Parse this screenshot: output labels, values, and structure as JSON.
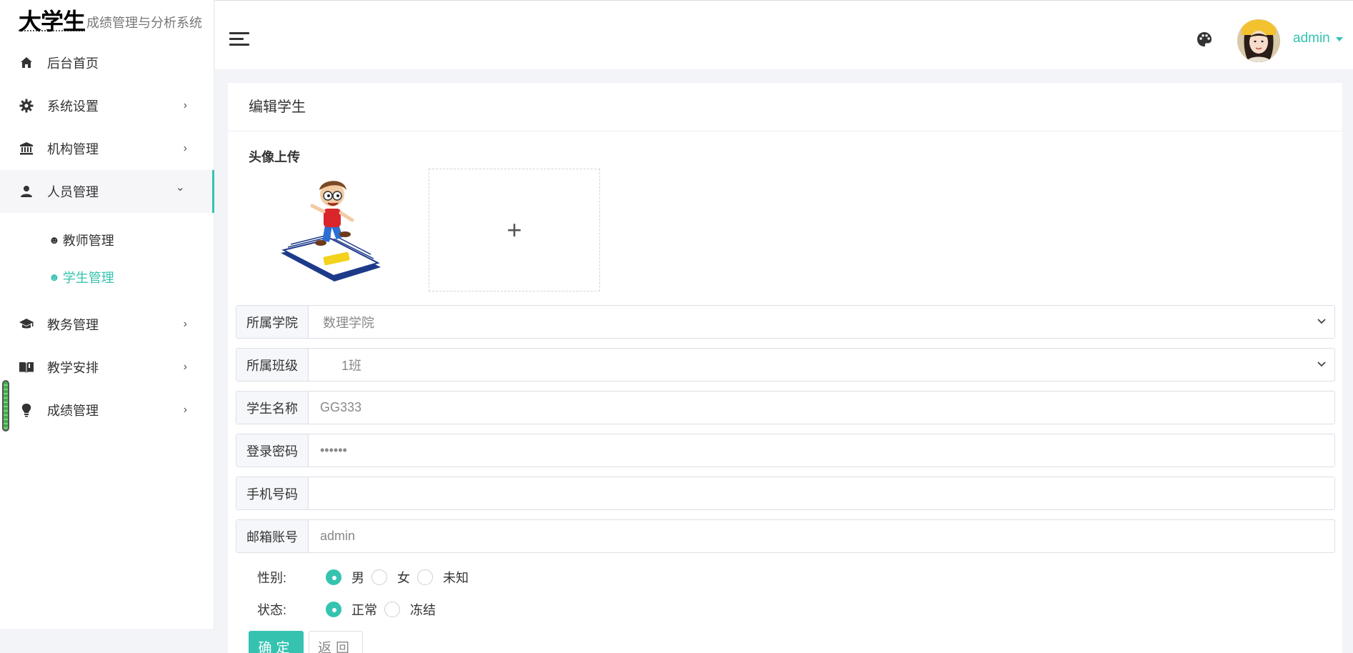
{
  "brand": {
    "big": "大学生",
    "small": "成绩管理与分析系统"
  },
  "sidebar": {
    "items": [
      {
        "label": "后台首页",
        "icon": "home-icon"
      },
      {
        "label": "系统设置",
        "icon": "gear-icon",
        "arrow": "›"
      },
      {
        "label": "机构管理",
        "icon": "institution-icon",
        "arrow": "›"
      },
      {
        "label": "人员管理",
        "icon": "person-icon",
        "arrow": "⌄"
      },
      {
        "label": "教务管理",
        "icon": "graduation-cap-icon",
        "arrow": "›"
      },
      {
        "label": "教学安排",
        "icon": "book-icon",
        "arrow": "›"
      },
      {
        "label": "成绩管理",
        "icon": "bulb-icon",
        "arrow": "›"
      }
    ],
    "sub_items": [
      {
        "label": "教师管理",
        "icon": "smile-icon"
      },
      {
        "label": "学生管理",
        "icon": "smile-icon"
      }
    ]
  },
  "header": {
    "user_name": "admin"
  },
  "card": {
    "title": "编辑学生",
    "upload_label": "头像上传",
    "upload_plus": "+",
    "fields": {
      "college": {
        "label": "所属学院",
        "value": "数理学院"
      },
      "class": {
        "label": "所属班级",
        "value": "1班"
      },
      "name": {
        "label": "学生名称",
        "value": "GG333"
      },
      "password": {
        "label": "登录密码",
        "value": "666666"
      },
      "phone": {
        "label": "手机号码",
        "value": ""
      },
      "email": {
        "label": "邮箱账号",
        "value": "admin"
      }
    },
    "gender": {
      "label": "性别:",
      "options": [
        "男",
        "女",
        "未知"
      ],
      "selected": "男"
    },
    "status": {
      "label": "状态:",
      "options": [
        "正常",
        "冻结"
      ],
      "selected": "正常"
    },
    "buttons": {
      "ok": "确定",
      "back": "返回"
    }
  },
  "colors": {
    "accent": "#35c3b0",
    "page_bg": "#f3f4f8"
  }
}
